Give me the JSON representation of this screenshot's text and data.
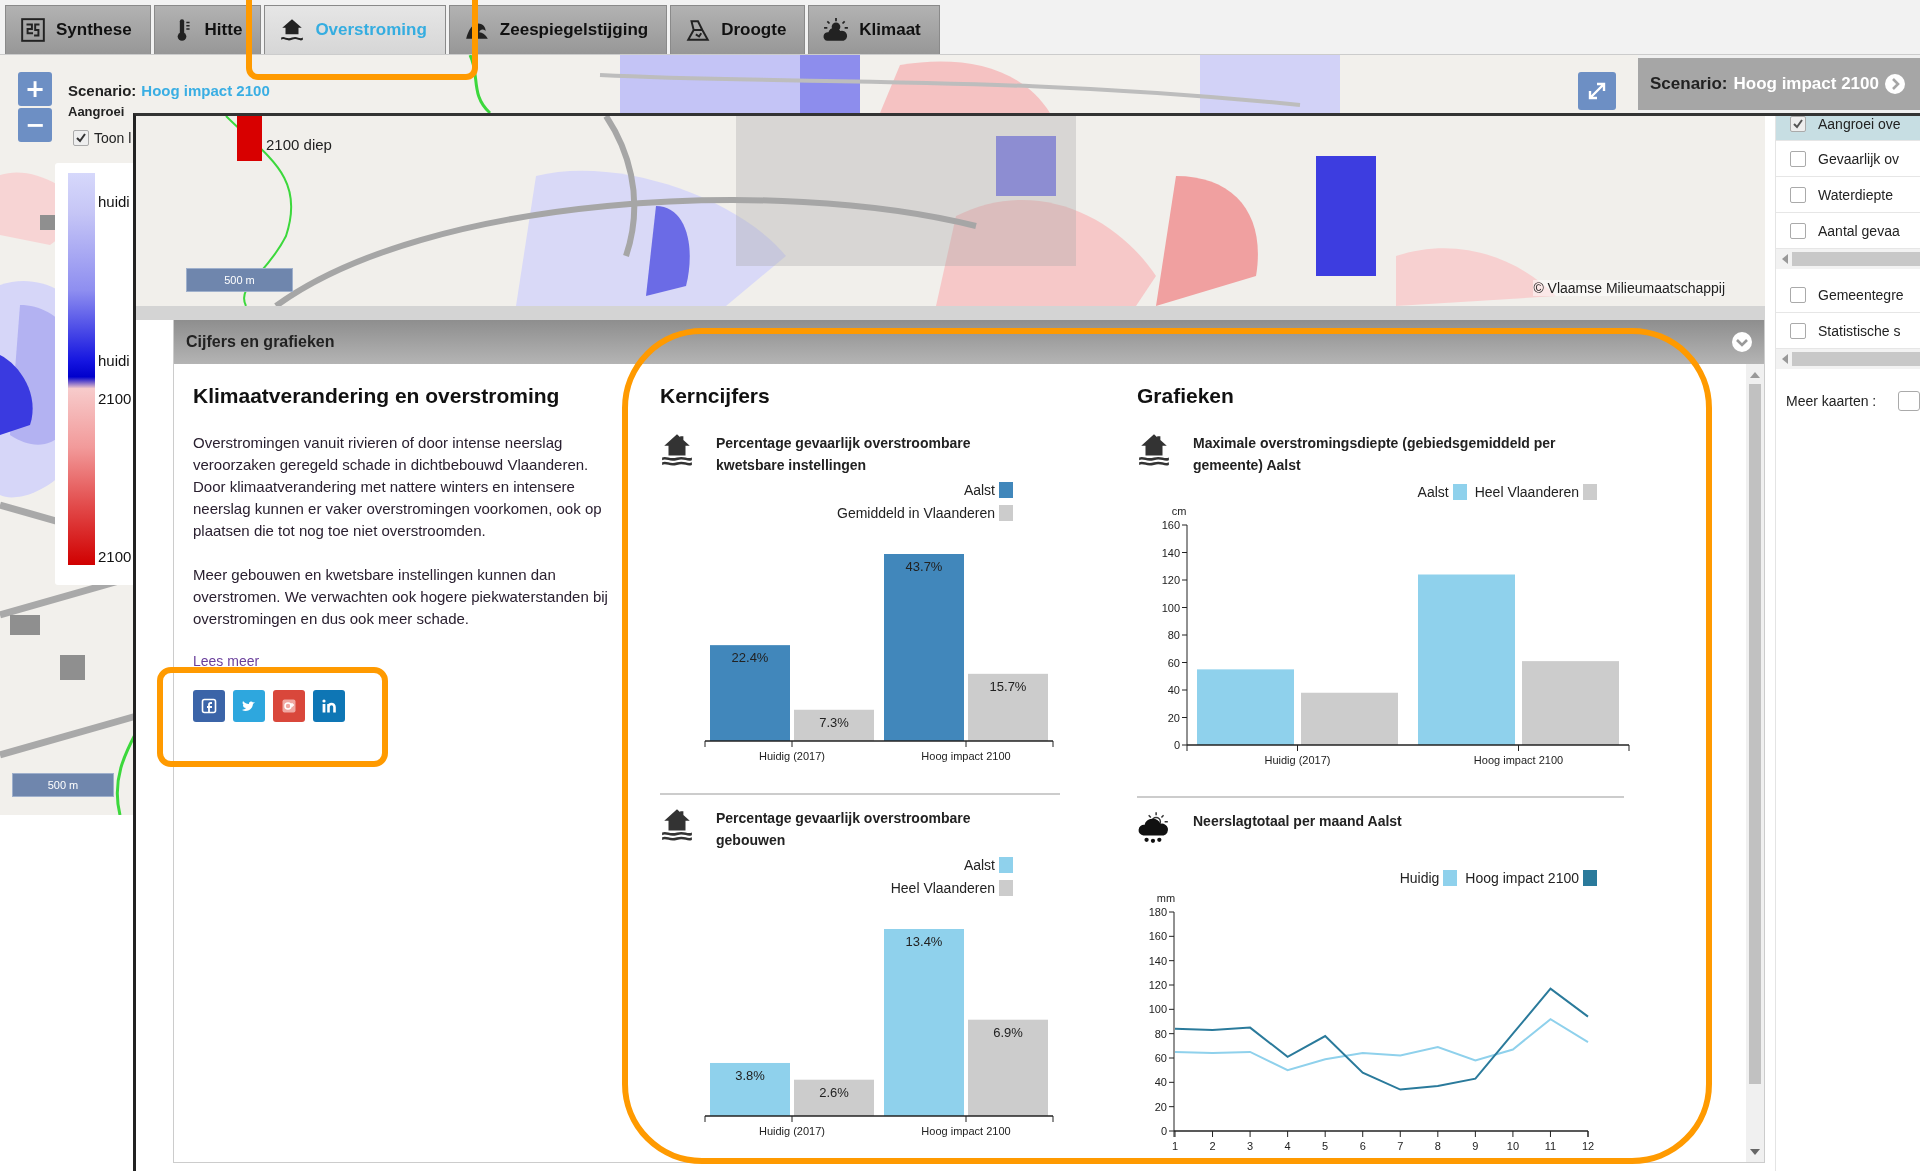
{
  "tabs": [
    {
      "label": "Synthese",
      "kind": "synthese",
      "selected": false
    },
    {
      "label": "Hitte",
      "kind": "hitte",
      "selected": false
    },
    {
      "label": "Overstroming",
      "kind": "overstroming",
      "selected": true
    },
    {
      "label": "Zeespiegelstijging",
      "kind": "zeespiegel",
      "selected": false
    },
    {
      "label": "Droogte",
      "kind": "droogte",
      "selected": false
    },
    {
      "label": "Klimaat",
      "kind": "klimaat",
      "selected": false
    }
  ],
  "map": {
    "zoom": [
      "+",
      "−"
    ],
    "scenario_label": "Scenario:",
    "scenario_value": "Hoog impact 2100",
    "layer_name": "Aangroei",
    "show_label": "Toon l",
    "show_checked": true,
    "legend": [
      "huidi",
      "huidi",
      "2100",
      "2100"
    ],
    "scale": "500 m"
  },
  "scenario_header": {
    "label": "Scenario:",
    "value": "Hoog impact 2100"
  },
  "detail_map": {
    "legend_label": "2100 diep",
    "scale": "500 m",
    "attribution": "© Vlaamse Milieumaatschappij"
  },
  "layers": {
    "groups": [
      [
        {
          "label": "Aangroei ove",
          "checked": true,
          "selected": true
        },
        {
          "label": "Gevaarlijk ov",
          "checked": false,
          "selected": false
        },
        {
          "label": "Waterdiepte",
          "checked": false,
          "selected": false
        },
        {
          "label": "Aantal gevaa",
          "checked": false,
          "selected": false
        }
      ],
      [
        {
          "label": "Gemeentegre",
          "checked": false,
          "selected": false
        },
        {
          "label": "Statistische s",
          "checked": false,
          "selected": false
        }
      ]
    ],
    "more_label": "Meer kaarten :"
  },
  "panel": {
    "title": "Cijfers en grafieken",
    "intro": {
      "heading": "Klimaatverandering en overstroming",
      "paragraphs": [
        "Overstromingen vanuit rivieren of door intense neerslag veroorzaken geregeld schade in dichtbebouwd Vlaanderen. Door klimaatverandering met nattere winters en intensere neerslag kunnen er vaker overstromingen voorkomen, ook op plaatsen die tot nog toe niet overstroomden.",
        "Meer gebouwen en kwetsbare instellingen kunnen dan overstromen. We verwachten ook hogere piekwaterstanden bij overstromingen en dus ook meer schade."
      ],
      "link": "Lees meer"
    },
    "social": [
      {
        "kind": "facebook",
        "color": "#3b64a8"
      },
      {
        "kind": "twitter",
        "color": "#2ea7de"
      },
      {
        "kind": "google",
        "color": "#d9473b"
      },
      {
        "kind": "linkedin",
        "color": "#0e76b5"
      }
    ],
    "key_figures": {
      "heading": "Kerncijfers",
      "charts": [
        {
          "kind": "flood",
          "chart_data": {
            "type": "bar",
            "title": "Percentage gevaarlijk overstroombare kwetsbare instellingen",
            "categories": [
              "Huidig (2017)",
              "Hoog impact 2100"
            ],
            "series": [
              {
                "name": "Aalst",
                "color": "#4187bb",
                "values": [
                  22.4,
                  43.7
                ],
                "value_labels": [
                  "22.4%",
                  "43.7%"
                ]
              },
              {
                "name": "Gemiddeld in Vlaanderen",
                "color": "#cccccc",
                "values": [
                  7.3,
                  15.7
                ],
                "value_labels": [
                  "7.3%",
                  "15.7%"
                ]
              }
            ]
          }
        },
        {
          "kind": "flood",
          "chart_data": {
            "type": "bar",
            "title": "Percentage gevaarlijk overstroombare gebouwen",
            "categories": [
              "Huidig (2017)",
              "Hoog impact 2100"
            ],
            "series": [
              {
                "name": "Aalst",
                "color": "#8fd1ec",
                "values": [
                  3.8,
                  13.4
                ],
                "value_labels": [
                  "3.8%",
                  "13.4%"
                ]
              },
              {
                "name": "Heel Vlaanderen",
                "color": "#cccccc",
                "values": [
                  2.6,
                  6.9
                ],
                "value_labels": [
                  "2.6%",
                  "6.9%"
                ]
              }
            ]
          }
        }
      ]
    },
    "graphs": {
      "heading": "Grafieken",
      "charts": [
        {
          "kind": "flood",
          "chart_data": {
            "type": "bar",
            "title": "Maximale overstromingsdiepte (gebiedsgemiddeld per gemeente) Aalst",
            "ylabel": "cm",
            "categories": [
              "Huidig (2017)",
              "Hoog impact 2100"
            ],
            "ylim": [
              0,
              160
            ],
            "yticks": [
              0,
              20,
              40,
              60,
              80,
              100,
              120,
              140,
              160
            ],
            "series": [
              {
                "name": "Aalst",
                "color": "#8fd1ec",
                "values": [
                  55,
                  124
                ]
              },
              {
                "name": "Heel Vlaanderen",
                "color": "#cccccc",
                "values": [
                  38,
                  61
                ]
              }
            ]
          }
        },
        {
          "kind": "rain",
          "chart_data": {
            "type": "line",
            "title": "Neerslagtotaal per maand Aalst",
            "ylabel": "mm",
            "x": [
              "1",
              "2",
              "3",
              "4",
              "5",
              "6",
              "7",
              "8",
              "9",
              "10",
              "11",
              "12"
            ],
            "ylim": [
              0,
              180
            ],
            "yticks": [
              0,
              20,
              40,
              60,
              80,
              100,
              120,
              140,
              160,
              180
            ],
            "series": [
              {
                "name": "Huidig",
                "color": "#8fd1ec",
                "values": [
                  65,
                  64,
                  65,
                  50,
                  59,
                  64,
                  62,
                  69,
                  58,
                  67,
                  92,
                  73
                ]
              },
              {
                "name": "Hoog impact 2100",
                "color": "#2a7a9b",
                "values": [
                  84,
                  83,
                  85,
                  61,
                  78,
                  48,
                  34,
                  37,
                  43,
                  80,
                  117,
                  94
                ]
              }
            ]
          }
        }
      ]
    }
  }
}
